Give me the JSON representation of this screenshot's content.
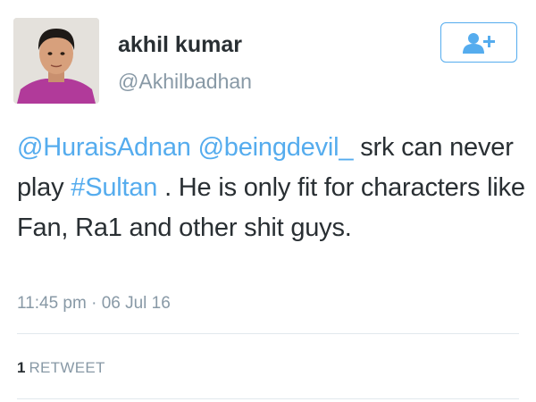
{
  "author": {
    "name": "akhil kumar",
    "handle": "@Akhilbadhan",
    "avatar_icon": "profile-photo"
  },
  "follow_button": {
    "icon": "add-user-icon",
    "color": "#55acee"
  },
  "tweet": {
    "mention_1": "@HuraisAdnan",
    "mention_2": "@beingdevil_",
    "text_1": " srk can never play ",
    "hashtag": "#Sultan",
    "text_2": " . He is only fit for characters like Fan, Ra1 and other shit guys."
  },
  "meta": {
    "time": "11:45 pm",
    "separator": " · ",
    "date": "06 Jul 16"
  },
  "stats": {
    "retweet_count": "1",
    "retweet_label": "RETWEET"
  },
  "colors": {
    "link": "#55acee",
    "text": "#292f33",
    "muted": "#8899a6"
  }
}
